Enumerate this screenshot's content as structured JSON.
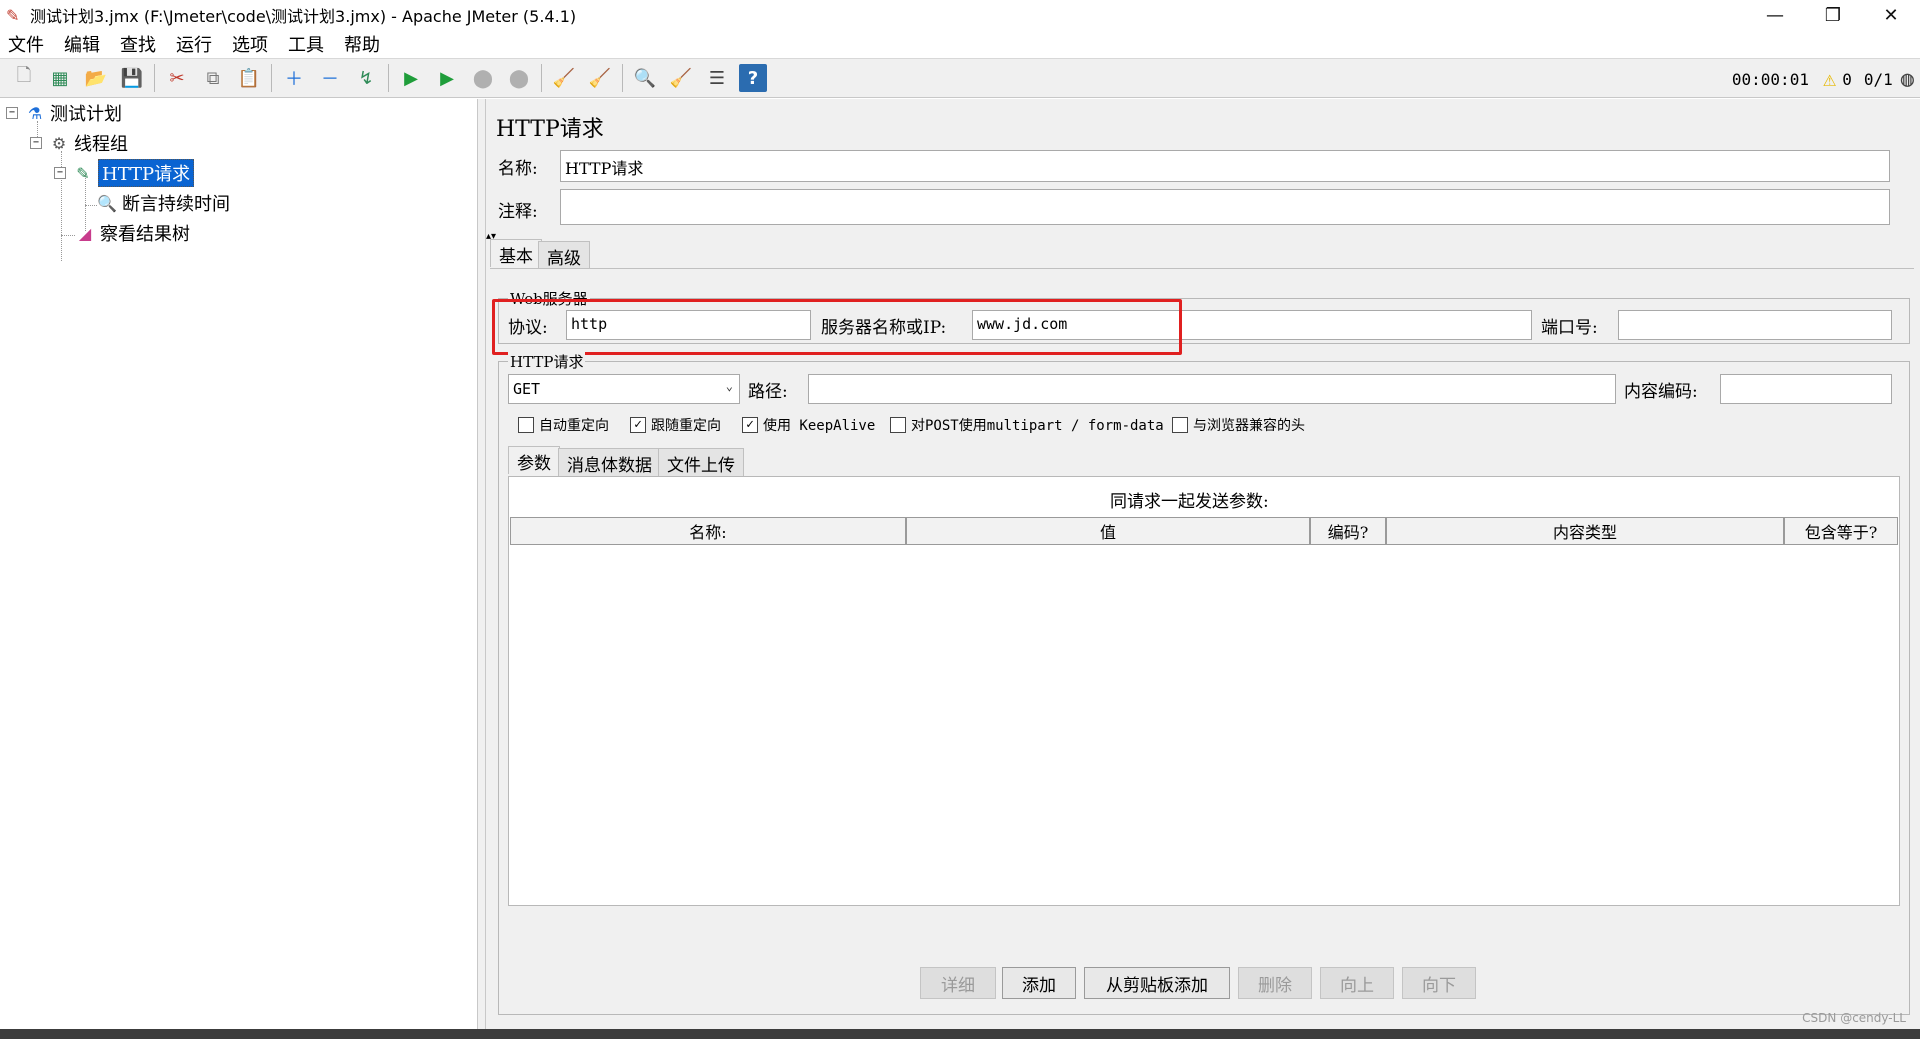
{
  "window": {
    "title": "测试计划3.jmx (F:\\Jmeter\\code\\测试计划3.jmx) - Apache JMeter (5.4.1)",
    "controls": [
      "—",
      "❐",
      "✕"
    ]
  },
  "menu": [
    "文件",
    "编辑",
    "查找",
    "运行",
    "选项",
    "工具",
    "帮助"
  ],
  "toolbar": {
    "timer": "00:00:01",
    "warning_count": "0",
    "threads": "0/1"
  },
  "tree": {
    "nodes": [
      {
        "label": "测试计划",
        "icon": "test-plan-icon"
      },
      {
        "label": "线程组",
        "icon": "thread-group-icon"
      },
      {
        "label": "HTTP请求",
        "icon": "http-sampler-icon"
      },
      {
        "label": "断言持续时间",
        "icon": "assertion-icon"
      },
      {
        "label": "察看结果树",
        "icon": "results-tree-icon"
      }
    ]
  },
  "panel": {
    "title": "HTTP请求",
    "name_label": "名称:",
    "name_value": "HTTP请求",
    "comment_label": "注释:",
    "comment_value": "",
    "tabs": [
      "基本",
      "高级"
    ],
    "web_server": {
      "group_title": "Web服务器",
      "protocol_label": "协议:",
      "protocol_value": "http",
      "server_label": "服务器名称或IP:",
      "server_value": "www.jd.com",
      "port_label": "端口号:",
      "port_value": ""
    },
    "http_request": {
      "group_title": "HTTP请求",
      "method": "GET",
      "path_label": "路径:",
      "path_value": "",
      "encoding_label": "内容编码:",
      "encoding_value": "",
      "checkboxes": [
        {
          "label": "自动重定向",
          "checked": false
        },
        {
          "label": "跟随重定向",
          "checked": true
        },
        {
          "label": "使用 KeepAlive",
          "checked": true
        },
        {
          "label": "对POST使用multipart / form-data",
          "checked": false
        },
        {
          "label": "与浏览器兼容的头",
          "checked": false
        }
      ],
      "subtabs": [
        "参数",
        "消息体数据",
        "文件上传"
      ],
      "table_caption": "同请求一起发送参数:",
      "columns": [
        "名称:",
        "值",
        "编码?",
        "内容类型",
        "包含等于?"
      ]
    },
    "buttons": [
      {
        "label": "详细",
        "enabled": false
      },
      {
        "label": "添加",
        "enabled": true
      },
      {
        "label": "从剪贴板添加",
        "enabled": true
      },
      {
        "label": "删除",
        "enabled": false
      },
      {
        "label": "向上",
        "enabled": false
      },
      {
        "label": "向下",
        "enabled": false
      }
    ]
  },
  "watermark": "CSDN @cendy-LL"
}
